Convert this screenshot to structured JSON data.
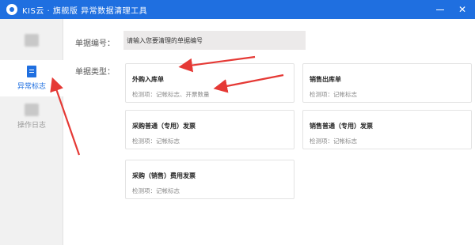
{
  "window": {
    "title": "KIS云 · 旗舰版 异常数据清理工具",
    "minimize_icon": "minimize-icon",
    "close_symbol": "✕"
  },
  "sidebar": {
    "items": [
      {
        "label": "",
        "icon": "blurred-icon",
        "active": false
      },
      {
        "label": "异常标志",
        "icon": "document-icon",
        "active": true
      },
      {
        "label": "操作日志",
        "icon": "blurred-icon",
        "active": false
      }
    ]
  },
  "form": {
    "bill_number_label": "单据编号：",
    "bill_number_placeholder": "请输入您要清理的单据编号",
    "bill_type_label": "单据类型："
  },
  "bill_types": [
    {
      "title": "外购入库单",
      "desc": "检测项：记帐标志、开票数量"
    },
    {
      "title": "销售出库单",
      "desc": "检测项：记帐标志"
    },
    {
      "title": "采购普通（专用）发票",
      "desc": "检测项：记帐标志"
    },
    {
      "title": "销售普通（专用）发票",
      "desc": "检测项：记帐标志"
    },
    {
      "title": "采购（销售）费用发票",
      "desc": "检测项：记帐标志"
    }
  ],
  "colors": {
    "accent": "#1f6fe0",
    "annotation_arrow": "#e53935"
  }
}
